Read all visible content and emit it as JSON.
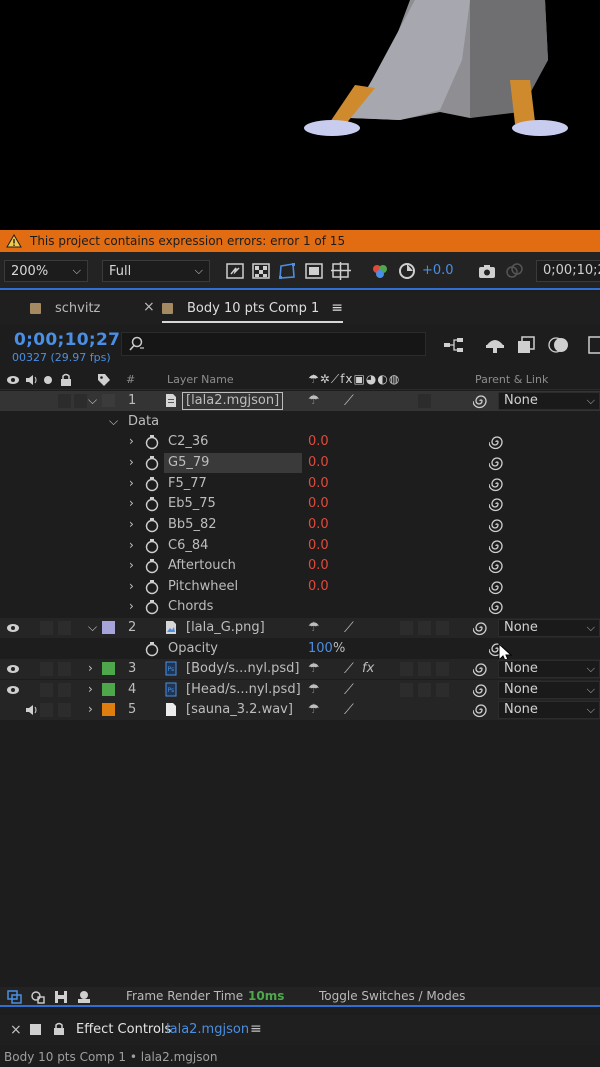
{
  "warning": {
    "text": "This project contains expression errors: error 1 of 15"
  },
  "viewer_toolbar": {
    "zoom": "200%",
    "resolution": "Full",
    "exposure": "+0.0",
    "timecode": "0;00;10;2"
  },
  "tabs": [
    {
      "label": "schvitz"
    },
    {
      "label": "Body 10 pts Comp 1"
    }
  ],
  "timeline": {
    "timecode": "0;00;10;27",
    "frame_info": "00327 (29.97 fps)",
    "search_placeholder": ""
  },
  "columns": {
    "number": "#",
    "layer_name": "Layer Name",
    "parent_link": "Parent & Link"
  },
  "layers": [
    {
      "num": "1",
      "name": "[lala2.mgjson]",
      "parent": "None"
    },
    {
      "num": "2",
      "name": "[lala_G.png]",
      "parent": "None"
    },
    {
      "num": "3",
      "name": "[Body/s...nyl.psd]",
      "parent": "None"
    },
    {
      "num": "4",
      "name": "[Head/s...nyl.psd]",
      "parent": "None"
    },
    {
      "num": "5",
      "name": "[sauna_3.2.wav]",
      "parent": "None"
    }
  ],
  "data_group": {
    "label": "Data"
  },
  "data_props": [
    {
      "name": "C2_36",
      "value": "0.0"
    },
    {
      "name": "G5_79",
      "value": "0.0"
    },
    {
      "name": "F5_77",
      "value": "0.0"
    },
    {
      "name": "Eb5_75",
      "value": "0.0"
    },
    {
      "name": "Bb5_82",
      "value": "0.0"
    },
    {
      "name": "C6_84",
      "value": "0.0"
    },
    {
      "name": "Aftertouch",
      "value": "0.0"
    },
    {
      "name": "Pitchwheel",
      "value": "0.0"
    },
    {
      "name": "Chords",
      "value": ""
    }
  ],
  "opacity": {
    "label": "Opacity",
    "value": "100",
    "unit": "%"
  },
  "footer": {
    "render_label": "Frame Render Time",
    "render_value": "10ms",
    "toggle_label": "Toggle Switches / Modes"
  },
  "effect_controls": {
    "title": "Effect Controls",
    "target": "lala2.mgjson",
    "path": "Body 10 pts Comp 1 • lala2.mgjson"
  },
  "colors": {
    "accent_blue": "#4a8fe3",
    "warning_orange": "#e26c12",
    "value_red": "#e04a3b",
    "label_lavender": "#a7a4d9",
    "label_green": "#4ea84b",
    "label_orange": "#e07d0f",
    "label_tan": "#a38a63"
  }
}
